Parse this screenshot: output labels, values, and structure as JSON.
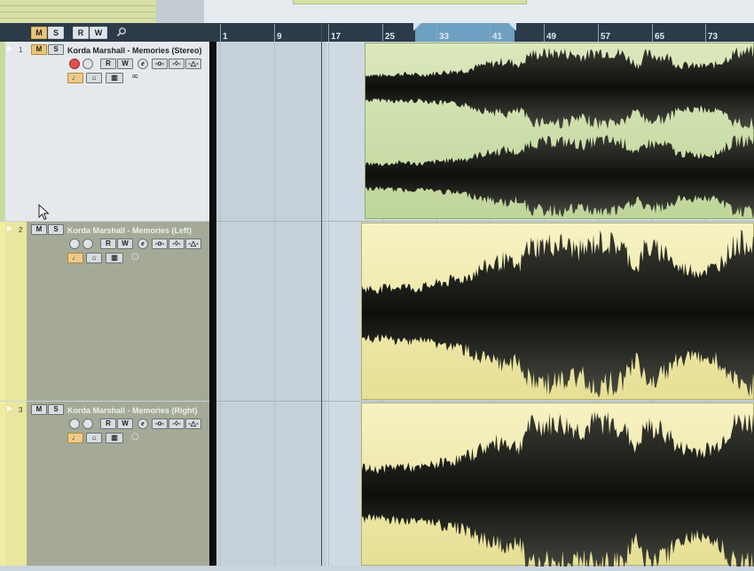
{
  "toolbar": {
    "mute_all": "M",
    "solo_all": "S",
    "read_all": "R",
    "write_all": "W"
  },
  "ruler": {
    "bars": [
      "1",
      "9",
      "17",
      "25",
      "33",
      "41",
      "49",
      "57",
      "65",
      "73"
    ]
  },
  "tracks": [
    {
      "number": "1",
      "name": "Korda Marshall - Memories (Stereo)",
      "m": "M",
      "s": "S",
      "r": "R",
      "w": "W",
      "e": "e",
      "link": "∞",
      "color": "#c7dba0"
    },
    {
      "number": "2",
      "name": "Korda Marshall - Memories (Left)",
      "m": "M",
      "s": "S",
      "r": "R",
      "w": "W",
      "e": "e",
      "link": "○",
      "color": "#f1eca0"
    },
    {
      "number": "3",
      "name": "Korda Marshall - Memories (Right)",
      "m": "M",
      "s": "S",
      "r": "R",
      "w": "W",
      "e": "e",
      "link": "○",
      "color": "#f1eca0"
    }
  ],
  "colors": {
    "ruler_bg": "#2b3b4a",
    "loop": "#6da0c2",
    "selected_track": "#e6e9ec",
    "track_bg": "#a4aa97",
    "event_green": "#c7dba0",
    "event_yellow": "#f1eca0",
    "waveform": "#1d1e1a",
    "mute_active": "#e9c779"
  }
}
